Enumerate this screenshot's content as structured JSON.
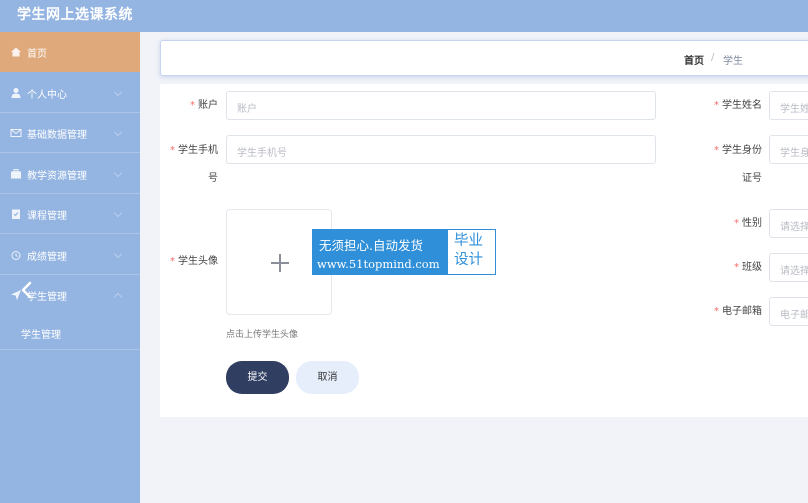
{
  "app": {
    "title": "学生网上选课系统"
  },
  "sidebar": {
    "items": [
      {
        "label": "首页",
        "icon": "home-icon"
      },
      {
        "label": "个人中心",
        "icon": "user-icon"
      },
      {
        "label": "基础数据管理",
        "icon": "mail-icon"
      },
      {
        "label": "教学资源管理",
        "icon": "briefcase-icon"
      },
      {
        "label": "课程管理",
        "icon": "clipboard-icon"
      },
      {
        "label": "成绩管理",
        "icon": "alarm-icon"
      },
      {
        "label": "学生管理",
        "icon": "send-icon"
      }
    ],
    "submenu": {
      "label": "学生管理"
    },
    "active_color": "#dfa97c",
    "background": "#94b4e2"
  },
  "breadcrumb": {
    "home": "首页",
    "separator": "/",
    "current": "学生"
  },
  "form": {
    "account": {
      "label": "账户",
      "placeholder": "账户"
    },
    "student_name": {
      "label": "学生姓名",
      "placeholder": "学生姓名"
    },
    "phone": {
      "label_line1": "学生手机",
      "label_line2": "号",
      "placeholder": "学生手机号"
    },
    "id_card": {
      "label_line1": "学生身份",
      "label_line2": "证号",
      "placeholder": "学生身份证号"
    },
    "gender": {
      "label": "性别",
      "placeholder": "请选择性别"
    },
    "class": {
      "label": "班级",
      "placeholder": "请选择班级"
    },
    "email": {
      "label": "电子邮箱",
      "placeholder": "电子邮箱"
    },
    "avatar": {
      "label": "学生头像",
      "hint": "点击上传学生头像"
    },
    "required_mark": "*"
  },
  "buttons": {
    "submit": "提交",
    "cancel": "取消"
  },
  "watermark": {
    "line1": "无须担心.自动发货",
    "line2": "www.51topmind.com",
    "right_line1": "毕业",
    "right_line2": "设计"
  }
}
